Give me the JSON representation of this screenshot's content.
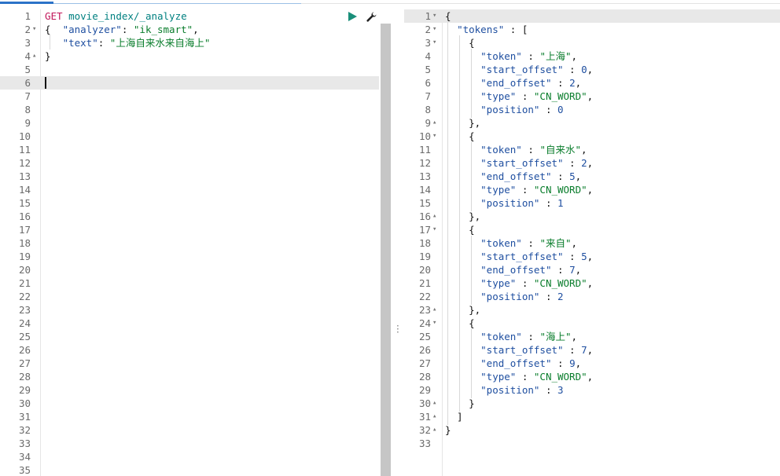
{
  "request": {
    "method": "GET",
    "url": "movie_index/_analyze",
    "body_lines": [
      {
        "num": "2",
        "fold": "▾",
        "parts": [
          [
            "t-punc",
            "{  "
          ],
          [
            "t-key",
            "\"analyzer\""
          ],
          [
            "t-punc",
            ": "
          ],
          [
            "t-str",
            "\"ik_smart\""
          ],
          [
            "t-punc",
            ","
          ]
        ]
      },
      {
        "num": "3",
        "fold": "",
        "parts": [
          [
            "t-punc",
            "   "
          ],
          [
            "t-key",
            "\"text\""
          ],
          [
            "t-punc",
            ": "
          ],
          [
            "t-str",
            "\"上海自来水来自海上\""
          ]
        ]
      },
      {
        "num": "4",
        "fold": "▴",
        "parts": [
          [
            "t-punc",
            "}"
          ]
        ]
      }
    ],
    "total_lines": 35,
    "active_line": 6
  },
  "response": {
    "lines": [
      {
        "num": "1",
        "fold": "▾",
        "text": "{"
      },
      {
        "num": "2",
        "fold": "▾",
        "text": "  \"tokens\" : ["
      },
      {
        "num": "3",
        "fold": "▾",
        "text": "    {"
      },
      {
        "num": "4",
        "fold": "",
        "text": "      \"token\" : \"上海\","
      },
      {
        "num": "5",
        "fold": "",
        "text": "      \"start_offset\" : 0,"
      },
      {
        "num": "6",
        "fold": "",
        "text": "      \"end_offset\" : 2,"
      },
      {
        "num": "7",
        "fold": "",
        "text": "      \"type\" : \"CN_WORD\","
      },
      {
        "num": "8",
        "fold": "",
        "text": "      \"position\" : 0"
      },
      {
        "num": "9",
        "fold": "▴",
        "text": "    },"
      },
      {
        "num": "10",
        "fold": "▾",
        "text": "    {"
      },
      {
        "num": "11",
        "fold": "",
        "text": "      \"token\" : \"自来水\","
      },
      {
        "num": "12",
        "fold": "",
        "text": "      \"start_offset\" : 2,"
      },
      {
        "num": "13",
        "fold": "",
        "text": "      \"end_offset\" : 5,"
      },
      {
        "num": "14",
        "fold": "",
        "text": "      \"type\" : \"CN_WORD\","
      },
      {
        "num": "15",
        "fold": "",
        "text": "      \"position\" : 1"
      },
      {
        "num": "16",
        "fold": "▴",
        "text": "    },"
      },
      {
        "num": "17",
        "fold": "▾",
        "text": "    {"
      },
      {
        "num": "18",
        "fold": "",
        "text": "      \"token\" : \"来自\","
      },
      {
        "num": "19",
        "fold": "",
        "text": "      \"start_offset\" : 5,"
      },
      {
        "num": "20",
        "fold": "",
        "text": "      \"end_offset\" : 7,"
      },
      {
        "num": "21",
        "fold": "",
        "text": "      \"type\" : \"CN_WORD\","
      },
      {
        "num": "22",
        "fold": "",
        "text": "      \"position\" : 2"
      },
      {
        "num": "23",
        "fold": "▴",
        "text": "    },"
      },
      {
        "num": "24",
        "fold": "▾",
        "text": "    {"
      },
      {
        "num": "25",
        "fold": "",
        "text": "      \"token\" : \"海上\","
      },
      {
        "num": "26",
        "fold": "",
        "text": "      \"start_offset\" : 7,"
      },
      {
        "num": "27",
        "fold": "",
        "text": "      \"end_offset\" : 9,"
      },
      {
        "num": "28",
        "fold": "",
        "text": "      \"type\" : \"CN_WORD\","
      },
      {
        "num": "29",
        "fold": "",
        "text": "      \"position\" : 3"
      },
      {
        "num": "30",
        "fold": "▴",
        "text": "    }"
      },
      {
        "num": "31",
        "fold": "▴",
        "text": "  ]"
      },
      {
        "num": "32",
        "fold": "▴",
        "text": "}"
      },
      {
        "num": "33",
        "fold": "",
        "text": ""
      }
    ]
  },
  "toolbar": {
    "run_icon": "play-icon",
    "settings_icon": "wrench-icon"
  },
  "colors": {
    "method": "#c2185b",
    "url": "#008080",
    "key": "#1f4fa0",
    "string": "#0a7d2c",
    "run": "#1a8f7a"
  }
}
